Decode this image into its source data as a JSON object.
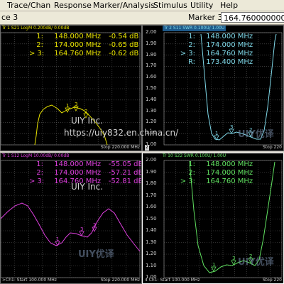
{
  "menu": [
    "Trace/Chan",
    "Response",
    "Marker/Analysis",
    "Stimulus",
    "Utility",
    "Help"
  ],
  "toolbar": {
    "left_text": "ce 3",
    "marker_label": "Marker 3",
    "marker_value": "164.760000000 MHz"
  },
  "watermark": {
    "company": "UIY Inc.",
    "url": "https://uiy832.en.china.cn/",
    "logo_text": "UIY优译"
  },
  "panels": [
    {
      "header": "Tr 1  S21 LogM 0.200dB/  0.00dB",
      "footer_left": "",
      "footer_right": "Stop  220.000 MHz",
      "color": "#e8e300",
      "yticks": [],
      "markers": [
        {
          "n": "1:",
          "freq": "148.000 MHz",
          "val": "-0.54 dB"
        },
        {
          "n": "2:",
          "freq": "174.000 MHz",
          "val": "-0.65 dB"
        },
        {
          "n": "> 3:",
          "freq": "164.760 MHz",
          "val": "-0.62 dB"
        }
      ]
    },
    {
      "header": "Tr 2  S11 SWR 0.100U/  1.00U",
      "footer_left": "2",
      "footer_right": "Stop  220",
      "color": "#7fd8e8",
      "yticks": [
        "2.00",
        "1.90",
        "1.80",
        "1.70",
        "1.60",
        "1.50",
        "1.40",
        "1.30",
        "1.20",
        "1.10",
        "1.00"
      ],
      "markers": [
        {
          "n": "1:",
          "freq": "148.000 MHz",
          "val": ""
        },
        {
          "n": "2:",
          "freq": "174.000 MHz",
          "val": ""
        },
        {
          "n": "> 3:",
          "freq": "164.760 MHz",
          "val": ""
        },
        {
          "n": "R:",
          "freq": "173.400 MHz",
          "val": ""
        }
      ]
    },
    {
      "header": "Tr 1  S12 LogM 10.00dB/  0.00dB",
      "footer_left": ">Ch1: Start  100.000 MHz",
      "footer_right": "Stop  220.000 MHz",
      "color": "#e040e0",
      "yticks": [],
      "markers": [
        {
          "n": "1:",
          "freq": "148.000 MHz",
          "val": "-55.05 dB"
        },
        {
          "n": "2:",
          "freq": "174.000 MHz",
          "val": "-57.21 dB"
        },
        {
          "n": "> 3:",
          "freq": "164.760 MHz",
          "val": "-52.81 dB"
        }
      ]
    },
    {
      "header": "Tr 10  S22 SWR 0.100U/  1.00U",
      "footer_left": "4   Ch1: Start  100.000 MHz",
      "footer_right": "Stop  220",
      "color": "#60e060",
      "yticks": [
        "2.00",
        "1.90",
        "1.80",
        "1.70",
        "1.60",
        "1.50",
        "1.40",
        "1.30",
        "1.20",
        "1.10",
        "1.00"
      ],
      "markers": [
        {
          "n": "1:",
          "freq": "148.000 MHz",
          "val": ""
        },
        {
          "n": "2:",
          "freq": "174.000 MHz",
          "val": ""
        },
        {
          "n": "> 3:",
          "freq": "164.760 MHz",
          "val": ""
        }
      ]
    }
  ]
}
